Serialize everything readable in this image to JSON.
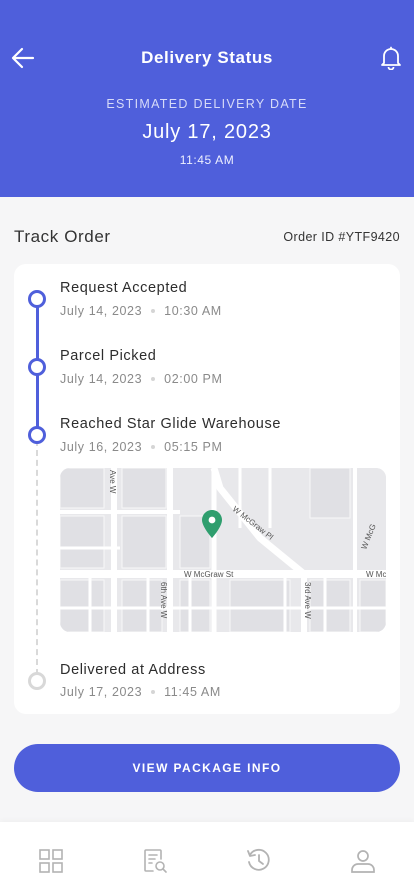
{
  "header": {
    "title": "Delivery Status",
    "eta_label": "ESTIMATED DELIVERY DATE",
    "eta_date": "July 17, 2023",
    "eta_time": "11:45 AM"
  },
  "track": {
    "title": "Track Order",
    "order_id": "Order ID #YTF9420"
  },
  "steps": [
    {
      "title": "Request Accepted",
      "date": "July 14, 2023",
      "time": "10:30 AM",
      "status": "done"
    },
    {
      "title": "Parcel Picked",
      "date": "July 14, 2023",
      "time": "02:00 PM",
      "status": "done"
    },
    {
      "title": "Reached Star Glide Warehouse",
      "date": "July 16, 2023",
      "time": "05:15 PM",
      "status": "done"
    },
    {
      "title": "Delivered at Address",
      "date": "July 17, 2023",
      "time": "11:45 AM",
      "status": "pending"
    }
  ],
  "map": {
    "labels": {
      "street1": "W McGraw St",
      "street2": "W McGraw Pl",
      "street3": "6th Ave W",
      "street4": "3rd Ave W",
      "street5": "W McG",
      "street6": "W Mc",
      "street7": "Ave W"
    }
  },
  "cta": {
    "label": "VIEW PACKAGE INFO"
  },
  "nav": [
    "grid-icon",
    "search-document-icon",
    "history-icon",
    "profile-icon"
  ],
  "colors": {
    "accent": "#4f5fdb",
    "pin": "#2f9e6e",
    "pending": "#d8d8d8"
  }
}
